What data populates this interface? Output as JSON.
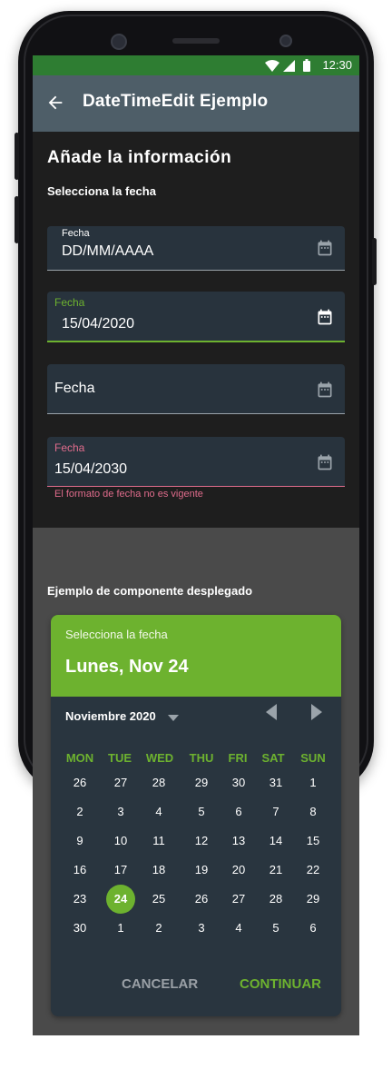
{
  "status_bar": {
    "time": "12:30"
  },
  "app_bar": {
    "title": "DateTimeEdit Ejemplo"
  },
  "form": {
    "heading": "Añade la información",
    "subheading": "Selecciona la fecha",
    "fields": [
      {
        "label": "Fecha",
        "value": "DD/MM/AAAA",
        "state": "default"
      },
      {
        "label": "Fecha",
        "value": "15/04/2020",
        "state": "focused"
      },
      {
        "label": "",
        "value": "Fecha",
        "state": "empty"
      },
      {
        "label": "Fecha",
        "value": "15/04/2030",
        "state": "error",
        "error": "El formato de fecha no es vigente"
      }
    ]
  },
  "example": {
    "title": "Ejemplo de componente desplegado",
    "picker": {
      "header_label": "Selecciona la fecha",
      "selected_text": "Lunes, Nov 24",
      "month": "Noviembre 2020",
      "weekdays": [
        "MON",
        "TUE",
        "WED",
        "THU",
        "FRI",
        "SAT",
        "SUN"
      ],
      "weeks": [
        [
          "26",
          "27",
          "28",
          "29",
          "30",
          "31",
          "1"
        ],
        [
          "2",
          "3",
          "4",
          "5",
          "6",
          "7",
          "8"
        ],
        [
          "9",
          "10",
          "11",
          "12",
          "13",
          "14",
          "15"
        ],
        [
          "16",
          "17",
          "18",
          "19",
          "20",
          "21",
          "22"
        ],
        [
          "23",
          "24",
          "25",
          "26",
          "27",
          "28",
          "29"
        ],
        [
          "30",
          "1",
          "2",
          "3",
          "4",
          "5",
          "6"
        ]
      ],
      "selected_day": "24",
      "cancel_label": "CANCELAR",
      "continue_label": "CONTINUAR"
    }
  },
  "colors": {
    "accent": "#6db22f",
    "status_bar": "#2e7d32",
    "app_bar": "#4e5e68",
    "error": "#e06c8c",
    "field_bg": "#28333d"
  },
  "icons": [
    "back-arrow-icon",
    "calendar-icon",
    "wifi-icon",
    "signal-icon",
    "battery-icon",
    "chevron-down-icon",
    "chevron-left-icon",
    "chevron-right-icon"
  ]
}
